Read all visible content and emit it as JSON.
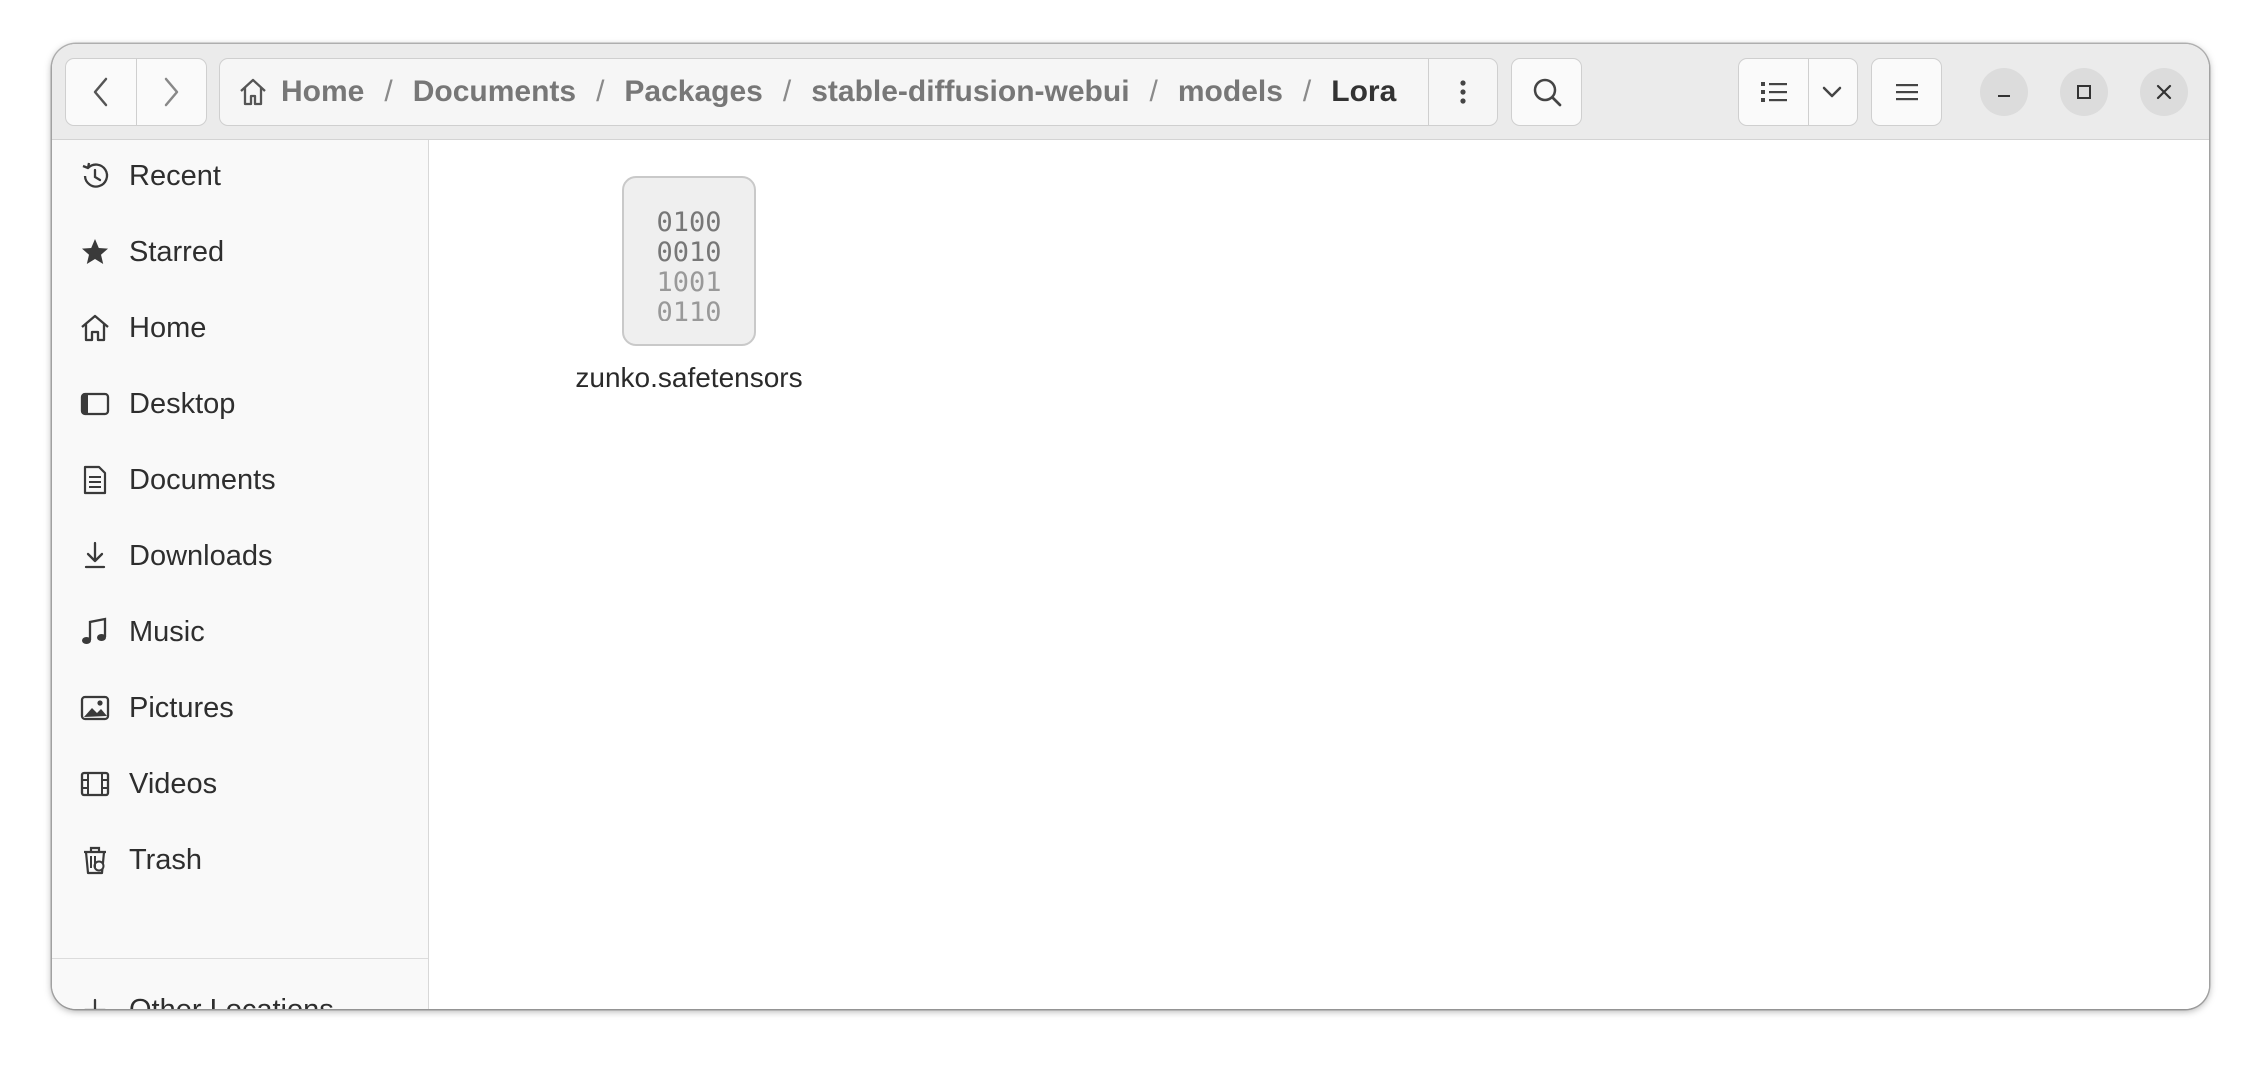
{
  "breadcrumb": [
    "Home",
    "Documents",
    "Packages",
    "stable-diffusion-webui",
    "models",
    "Lora"
  ],
  "breadcrumb_separator": "/",
  "sidebar": {
    "items": [
      {
        "label": "Recent",
        "icon": "recent-icon"
      },
      {
        "label": "Starred",
        "icon": "star-icon"
      },
      {
        "label": "Home",
        "icon": "home-icon"
      },
      {
        "label": "Desktop",
        "icon": "desktop-icon"
      },
      {
        "label": "Documents",
        "icon": "documents-icon"
      },
      {
        "label": "Downloads",
        "icon": "downloads-icon"
      },
      {
        "label": "Music",
        "icon": "music-icon"
      },
      {
        "label": "Pictures",
        "icon": "pictures-icon"
      },
      {
        "label": "Videos",
        "icon": "videos-icon"
      },
      {
        "label": "Trash",
        "icon": "trash-icon"
      }
    ],
    "other_locations": {
      "label": "Other Locations",
      "icon": "plus-icon"
    }
  },
  "files": [
    {
      "name": "zunko.safetensors",
      "icon": "binary-file-icon",
      "binary_rows": [
        "0100",
        "0010",
        "1001",
        "0110"
      ]
    }
  ],
  "colors": {
    "headerbar": "#ebebeb",
    "sidebar": "#f9f9f9",
    "content": "#ffffff"
  }
}
